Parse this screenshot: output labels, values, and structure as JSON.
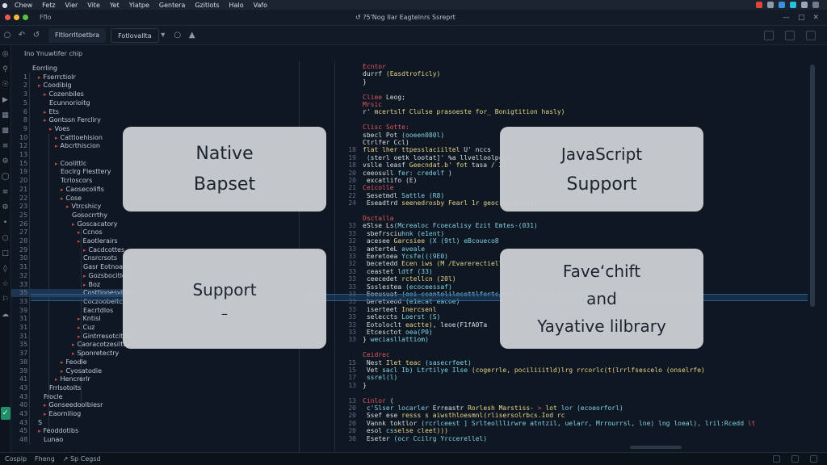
{
  "menubar": {
    "items": [
      "Chew",
      "Fetz",
      "Vier",
      "Vite",
      "Yet",
      "Ylatpe",
      "Gentera",
      "Gzitlots",
      "Halo",
      "Vafo"
    ],
    "colors": {
      "red": "#e0453a",
      "blue": "#3a8ee0",
      "cyan": "#23c3e0"
    }
  },
  "titlebar": {
    "left_label": "Fflo",
    "title": "↺ ?5'Nog Ilar Eagtelnrs Ssreprt"
  },
  "toolbar": {
    "tab_primary": "Fltlorrltoetbra",
    "tab_secondary": "Fotlovallta"
  },
  "explorer": {
    "header": "Ino  Ynuwtifer  chip",
    "rows": [
      {
        "ln": "",
        "label": "Eorrling",
        "indent": 0,
        "arrow": false
      },
      {
        "ln": "1",
        "label": "Fserrctiolr",
        "indent": 1,
        "arrow": true
      },
      {
        "ln": "2",
        "label": "Coodiblg",
        "indent": 1,
        "arrow": true
      },
      {
        "ln": "3",
        "label": "Cozenbiles",
        "indent": 2,
        "arrow": true
      },
      {
        "ln": "5",
        "label": "Ecunnorioitg",
        "indent": 3,
        "arrow": false
      },
      {
        "ln": "6",
        "label": "Ets",
        "indent": 2,
        "arrow": true
      },
      {
        "ln": "8",
        "label": "Gontssn Fercliry",
        "indent": 2,
        "arrow": true
      },
      {
        "ln": "9",
        "label": "Voes",
        "indent": 3,
        "arrow": true
      },
      {
        "ln": "10",
        "label": "Cattloehision",
        "indent": 4,
        "arrow": true
      },
      {
        "ln": "12",
        "label": "Abcrthiscion",
        "indent": 4,
        "arrow": true
      },
      {
        "ln": "13",
        "label": "",
        "indent": 0,
        "arrow": false
      },
      {
        "ln": "15",
        "label": "Coolittlc",
        "indent": 4,
        "arrow": true
      },
      {
        "ln": "19",
        "label": "Eoclrg Flesttery",
        "indent": 5,
        "arrow": false
      },
      {
        "ln": "20",
        "label": "Tcrloscors",
        "indent": 5,
        "arrow": false
      },
      {
        "ln": "21",
        "label": "Caosecolifis",
        "indent": 5,
        "arrow": true
      },
      {
        "ln": "22",
        "label": "Cose",
        "indent": 5,
        "arrow": true
      },
      {
        "ln": "23",
        "label": "Vtrcshicy",
        "indent": 6,
        "arrow": true
      },
      {
        "ln": "25",
        "label": "Gosocrrthy",
        "indent": 7,
        "arrow": false
      },
      {
        "ln": "26",
        "label": "Goscacatory",
        "indent": 7,
        "arrow": true
      },
      {
        "ln": "27",
        "label": "Ccnos",
        "indent": 8,
        "arrow": true
      },
      {
        "ln": "28",
        "label": "Eaotlerairs",
        "indent": 8,
        "arrow": true
      },
      {
        "ln": "29",
        "label": "Cacdcottes",
        "indent": 9,
        "arrow": true
      },
      {
        "ln": "30",
        "label": "Cnsrcrsots",
        "indent": 9,
        "arrow": false
      },
      {
        "ln": "31",
        "label": "Gasr Eotnoatry",
        "indent": 9,
        "arrow": false
      },
      {
        "ln": "32",
        "label": "Gozsbocitless",
        "indent": 9,
        "arrow": true
      },
      {
        "ln": "33",
        "label": "Boz",
        "indent": 9,
        "arrow": true
      },
      {
        "ln": "35",
        "label": "Costtiooesvliatt",
        "indent": 9,
        "arrow": false,
        "selected": true
      },
      {
        "ln": "33",
        "label": "Coczoobeltcrit",
        "indent": 9,
        "arrow": false
      },
      {
        "ln": "39",
        "label": "Eacrtdlos",
        "indent": 9,
        "arrow": false
      },
      {
        "ln": "31",
        "label": "Kntisl",
        "indent": 8,
        "arrow": true
      },
      {
        "ln": "31",
        "label": "Cuz",
        "indent": 8,
        "arrow": true
      },
      {
        "ln": "31",
        "label": "Gintrresotcitler",
        "indent": 8,
        "arrow": true
      },
      {
        "ln": "35",
        "label": "Caoracotzesiltty",
        "indent": 7,
        "arrow": true
      },
      {
        "ln": "37",
        "label": "Sponretectry",
        "indent": 7,
        "arrow": true
      },
      {
        "ln": "38",
        "label": "Feodle",
        "indent": 5,
        "arrow": true
      },
      {
        "ln": "39",
        "label": "Cyosatodie",
        "indent": 5,
        "arrow": true
      },
      {
        "ln": "41",
        "label": "Hencrerlr",
        "indent": 4,
        "arrow": true
      },
      {
        "ln": "43",
        "label": "Frrlsotoits",
        "indent": 3,
        "arrow": false
      },
      {
        "ln": "43",
        "label": "Frocle",
        "indent": 2,
        "arrow": false
      },
      {
        "ln": "40",
        "label": "Gonseedoolbiesr",
        "indent": 2,
        "arrow": true
      },
      {
        "ln": "43",
        "label": "Eaorniliog",
        "indent": 2,
        "arrow": true
      },
      {
        "ln": "43",
        "label": "S",
        "indent": 1,
        "arrow": false
      },
      {
        "ln": "45",
        "label": "Feoddotibs",
        "indent": 1,
        "arrow": true
      },
      {
        "ln": "48",
        "label": "Lunao",
        "indent": 2,
        "arrow": false
      }
    ]
  },
  "cards": {
    "native": [
      "Native",
      "Bapset"
    ],
    "javascript": [
      "JavaScript",
      "Support"
    ],
    "support": [
      "Support",
      "–"
    ],
    "favechift": [
      "Faveʻchift",
      "and",
      "Yayative lilbrary"
    ]
  },
  "editor": {
    "lines": [
      {
        "n": "",
        "parts": [
          [
            "kw",
            "Ecntor"
          ]
        ]
      },
      {
        "n": "",
        "parts": [
          [
            "tx",
            "durrf "
          ],
          [
            "fn",
            "(Easdtroficly)"
          ]
        ]
      },
      {
        "n": "",
        "parts": [
          [
            "tx",
            "}"
          ]
        ]
      },
      {
        "n": "",
        "parts": [
          [
            "tx",
            ""
          ]
        ]
      },
      {
        "n": "",
        "parts": [
          [
            "kw",
            "Cliee "
          ],
          [
            "tx",
            "Leog;"
          ]
        ]
      },
      {
        "n": "",
        "parts": [
          [
            "kw",
            "Mrsic"
          ]
        ]
      },
      {
        "n": "",
        "parts": [
          [
            "tx",
            "r' "
          ],
          [
            "fn",
            "mcertslf Clulse prasoeste for_ Bonigtition hasly)"
          ]
        ]
      },
      {
        "n": "",
        "parts": [
          [
            "tx",
            ""
          ]
        ]
      },
      {
        "n": "",
        "parts": [
          [
            "kw",
            "Clisc Sotte:"
          ]
        ]
      },
      {
        "n": "",
        "parts": [
          [
            "tx",
            "sbecl Pot "
          ],
          [
            "st",
            "(ooeen080l)"
          ]
        ]
      },
      {
        "n": "",
        "parts": [
          [
            "tx",
            "Ctrlfer Ccl)"
          ]
        ]
      },
      {
        "n": "18",
        "parts": [
          [
            "fn",
            "flat lher ttpesslaciiltel "
          ],
          [
            "tx",
            "U' nccs"
          ]
        ]
      },
      {
        "n": "19",
        "parts": [
          [
            "st",
            "  ("
          ],
          [
            "tx",
            "sterl oetk  lootat]' %a llvelloolpcsl"
          ]
        ]
      },
      {
        "n": "18",
        "parts": [
          [
            "tx",
            "vslle leasf "
          ],
          [
            "fn",
            "Geecndat.b' fot "
          ],
          [
            "tx",
            "tasa / 23"
          ]
        ]
      },
      {
        "n": "20",
        "parts": [
          [
            "tx",
            "ceeosull "
          ],
          [
            "st",
            "fer: credelf"
          ],
          [
            "tx",
            "  )"
          ]
        ]
      },
      {
        "n": "20",
        "parts": [
          [
            "tx",
            "      excatlifo (E)"
          ]
        ]
      },
      {
        "n": "21",
        "parts": [
          [
            "kw",
            "Ceicolle"
          ]
        ]
      },
      {
        "n": "22",
        "parts": [
          [
            "tx",
            " Sesetmdl "
          ],
          [
            "st",
            "Sattle (R8)"
          ]
        ]
      },
      {
        "n": "24",
        "parts": [
          [
            "tx",
            "  Eseadtrd "
          ],
          [
            "fn",
            "seenedrosby  Fearl 1r geocred eidad)"
          ]
        ]
      },
      {
        "n": "",
        "parts": [
          [
            "tx",
            ""
          ]
        ]
      },
      {
        "n": "",
        "parts": [
          [
            "kw",
            "Dsctalla"
          ]
        ]
      },
      {
        "n": "33",
        "parts": [
          [
            "tx",
            "eSlse Ls"
          ],
          [
            "st",
            "(Mcrealoc Fcoecalisy Ezit  Emtes-(031)"
          ]
        ]
      },
      {
        "n": "33",
        "parts": [
          [
            "tx",
            "  sbefrsciu"
          ],
          [
            "st",
            "hnk (e1ent)"
          ]
        ]
      },
      {
        "n": "32",
        "parts": [
          [
            "tx",
            "  acesee "
          ],
          [
            "fn",
            "Garcsiee "
          ],
          [
            "st",
            "(X (9tl) eBcoueco8"
          ]
        ]
      },
      {
        "n": "33",
        "parts": [
          [
            "tx",
            "  aeterteL "
          ],
          [
            "st",
            "aveale"
          ]
        ]
      },
      {
        "n": "33",
        "parts": [
          [
            "tx",
            "  Eeretoea "
          ],
          [
            "st",
            "Ycsfe(((9E0)"
          ]
        ]
      },
      {
        "n": "32",
        "parts": [
          [
            "tx",
            "  becetedd "
          ],
          [
            "fn",
            "Ecen iws (M /Evarerectiell"
          ]
        ]
      },
      {
        "n": "33",
        "parts": [
          [
            "tx",
            "  ceastet "
          ],
          [
            "st",
            "ldtf (33)"
          ]
        ]
      },
      {
        "n": "33",
        "parts": [
          [
            "tx",
            "  ceecedet "
          ],
          [
            "fn",
            "rctellcn (20l)"
          ]
        ]
      },
      {
        "n": "33",
        "parts": [
          [
            "tx",
            "  Ssslestea "
          ],
          [
            "st",
            "(ecoceessaf)"
          ]
        ]
      },
      {
        "n": "33",
        "parts": [
          [
            "tx",
            "  Eoeusuat "
          ],
          [
            "st",
            "(ooi ccontolilecottlfortc/oel lot, (oec 8oilulio/Soitl0 loewdtcl (Olscoeceel)"
          ]
        ]
      },
      {
        "n": "33",
        "parts": [
          [
            "tx",
            "  beretxeod "
          ],
          [
            "st",
            "(e1ecat eacoe)"
          ]
        ]
      },
      {
        "n": "33",
        "parts": [
          [
            "tx",
            "  iserteet "
          ],
          [
            "fn",
            "Inercsenl"
          ]
        ]
      },
      {
        "n": "33",
        "parts": [
          [
            "tx",
            "  seleccts "
          ],
          [
            "st",
            "Loerst (S)"
          ]
        ]
      },
      {
        "n": "33",
        "parts": [
          [
            "tx",
            "  Eotoloclt "
          ],
          [
            "fn",
            "eactte)"
          ],
          [
            "tx",
            ", leoe(F1fA0Ta"
          ]
        ]
      },
      {
        "n": "33",
        "parts": [
          [
            "tx",
            "  Etcesctot "
          ],
          [
            "st",
            "oea(P0)"
          ]
        ]
      },
      {
        "n": "33",
        "parts": [
          [
            "tx",
            "} "
          ],
          [
            "st",
            "weciasllattiom)"
          ]
        ]
      },
      {
        "n": "",
        "parts": [
          [
            "tx",
            ""
          ]
        ]
      },
      {
        "n": "",
        "parts": [
          [
            "kw",
            "Ceidrec"
          ]
        ]
      },
      {
        "n": "15",
        "parts": [
          [
            "tx",
            "  Nest  "
          ],
          [
            "fn",
            "Ilet teac "
          ],
          [
            "st",
            "(sasecrfeet)"
          ]
        ]
      },
      {
        "n": "15",
        "parts": [
          [
            "tx",
            "    Vet "
          ],
          [
            "st",
            "sacl  Ib) Ltrtilye Ilse "
          ],
          [
            "fn",
            "(cogerrle, pociliiitld)lrg rrcorlc(t(lrrlfsescelo (onselrfe)"
          ]
        ]
      },
      {
        "n": "17",
        "parts": [
          [
            "tx",
            "     "
          ],
          [
            "st",
            "ssrel(l)"
          ]
        ]
      },
      {
        "n": "13",
        "parts": [
          [
            "tx",
            "}"
          ]
        ]
      },
      {
        "n": "",
        "parts": [
          [
            "tx",
            ""
          ]
        ]
      },
      {
        "n": "13",
        "parts": [
          [
            "kw",
            "Cinlor "
          ],
          [
            "tx",
            "("
          ]
        ]
      },
      {
        "n": "20",
        "parts": [
          [
            "tx",
            "  "
          ],
          [
            "st",
            "c'Slser locarler "
          ],
          [
            "tx",
            "Erreastr "
          ],
          [
            "fn",
            "Rorlesh Marstiss- "
          ],
          [
            "kw",
            "> "
          ],
          [
            "fn",
            "lot "
          ],
          [
            "st",
            "lor (ecoeorforl)"
          ]
        ]
      },
      {
        "n": "20",
        "parts": [
          [
            "tx",
            "   Ssef ese  "
          ],
          [
            "fn",
            "resss  s aiwsthloesmnl(rlisersolrbcs.Iod rc"
          ]
        ]
      },
      {
        "n": "20",
        "parts": [
          [
            "tx",
            "     Vannk "
          ],
          [
            "tx",
            "toktlor "
          ],
          [
            "st",
            "(rcrlceest ]  Srlteolllirwre atntzil, uelarr, Mrrourrsl, lne) lng loeal), lril:Rcedd "
          ],
          [
            "kw",
            "lt"
          ]
        ]
      },
      {
        "n": "20",
        "parts": [
          [
            "tx",
            "     esol "
          ],
          [
            "st",
            "cs"
          ],
          [
            "fn",
            "selse cleet)))"
          ]
        ]
      },
      {
        "n": "30",
        "parts": [
          [
            "tx",
            "     Eseter "
          ],
          [
            "st",
            "(ocr  Ccilrg Yrccerellel)"
          ]
        ]
      }
    ]
  },
  "statusbar": {
    "left_items": [
      "Cospip",
      "Fheng",
      "↗ Sp Cegsd"
    ]
  }
}
